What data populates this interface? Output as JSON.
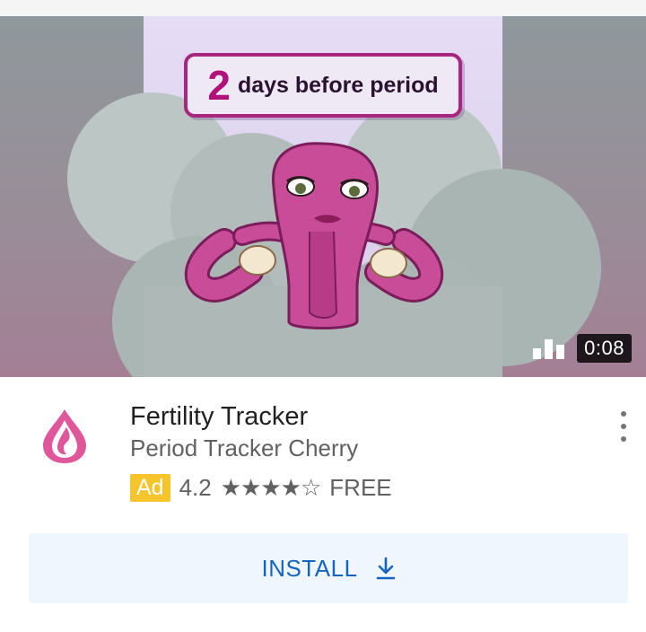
{
  "video": {
    "headline_number": "2",
    "headline_text": "days before period",
    "duration": "0:08"
  },
  "app": {
    "title": "Fertility Tracker",
    "developer": "Period Tracker Cherry",
    "ad_label": "Ad",
    "rating": "4.2",
    "stars_text": "★★★★☆",
    "price": "FREE"
  },
  "install": {
    "label": "INSTALL"
  },
  "icons": {
    "audio": "audio-bars-icon",
    "more": "more-vert-icon",
    "download": "download-icon",
    "app": "app-logo-icon"
  },
  "colors": {
    "ad_badge": "#f6c42b",
    "install_text": "#1565c0",
    "install_bg": "#f0f6fd",
    "brand_pink": "#e0569b"
  }
}
